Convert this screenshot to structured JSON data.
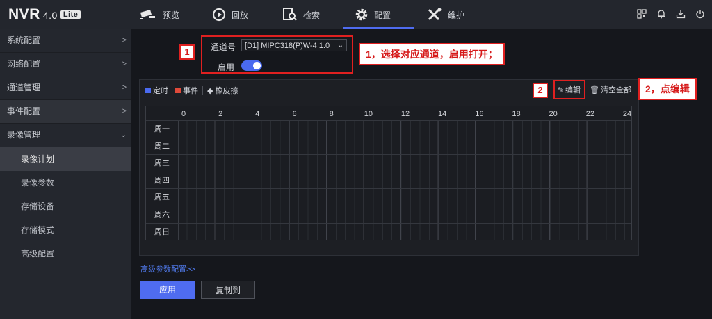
{
  "app": {
    "name": "NVR",
    "version": "4.0",
    "edition": "Lite"
  },
  "nav": [
    {
      "label": "预览",
      "icon": "camera-icon"
    },
    {
      "label": "回放",
      "icon": "play-icon"
    },
    {
      "label": "检索",
      "icon": "search-file-icon"
    },
    {
      "label": "配置",
      "icon": "gear-icon",
      "active": true
    },
    {
      "label": "维护",
      "icon": "tools-icon"
    }
  ],
  "top_icons": [
    "qr-code-icon",
    "bell-icon",
    "download-icon",
    "power-icon"
  ],
  "sidebar": {
    "items": [
      {
        "label": "系统配置",
        "expanded": false
      },
      {
        "label": "网络配置",
        "expanded": false
      },
      {
        "label": "通道管理",
        "expanded": false
      },
      {
        "label": "事件配置",
        "expanded": false
      },
      {
        "label": "录像管理",
        "expanded": true
      }
    ],
    "subitems": [
      {
        "label": "录像计划",
        "active": true
      },
      {
        "label": "录像参数"
      },
      {
        "label": "存储设备"
      },
      {
        "label": "存储模式"
      },
      {
        "label": "高级配置"
      }
    ]
  },
  "form": {
    "channel_label": "通道号",
    "channel_value": "[D1] MIPC318(P)W-4 1.0",
    "enable_label": "启用",
    "enable_on": true
  },
  "legend": {
    "timed": "定时",
    "timed_color": "#4a6af0",
    "event": "事件",
    "event_color": "#e04a3a",
    "eraser": "橡皮擦",
    "edit": "编辑",
    "clear_all": "清空全部"
  },
  "schedule": {
    "hours": [
      "0",
      "2",
      "4",
      "6",
      "8",
      "10",
      "12",
      "14",
      "16",
      "18",
      "20",
      "22",
      "24"
    ],
    "days": [
      "周一",
      "周二",
      "周三",
      "周四",
      "周五",
      "周六",
      "周日"
    ]
  },
  "advanced_link": "高级参数配置>>",
  "buttons": {
    "apply": "应用",
    "copy": "复制到"
  },
  "annotations": {
    "badge1": "1",
    "callout1": "1，选择对应通道，启用打开；",
    "badge2": "2",
    "callout2": "2，点编辑"
  }
}
